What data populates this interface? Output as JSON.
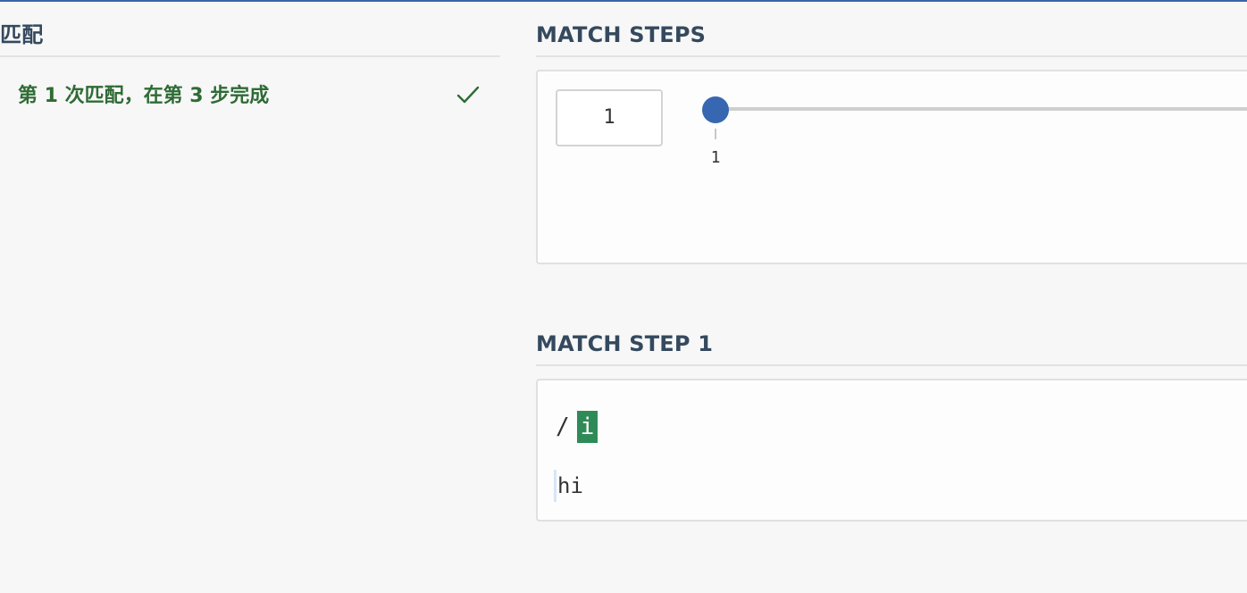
{
  "matches_panel": {
    "title": "匹配",
    "items": [
      {
        "label": "第 1 次匹配，在第 3 步完成",
        "status_icon": "check-icon"
      }
    ]
  },
  "match_steps": {
    "title": "MATCH STEPS",
    "current_step": "1",
    "slider": {
      "min": 1,
      "max": 1,
      "value": 1,
      "tick_label": "1"
    }
  },
  "match_step_detail": {
    "title": "MATCH STEP 1",
    "pattern_prefix": "/",
    "pattern_highlight": "i",
    "subject": "hi"
  },
  "colors": {
    "accent": "#3767b1",
    "success": "#2f6b35",
    "highlight": "#2e8b57",
    "heading": "#34495e"
  }
}
